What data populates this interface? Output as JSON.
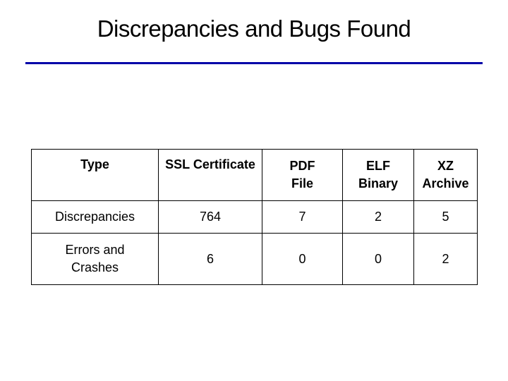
{
  "title": "Discrepancies and Bugs Found",
  "colors": {
    "rule": "#0000a8"
  },
  "table": {
    "headers": [
      {
        "lines": [
          "Type"
        ]
      },
      {
        "lines": [
          "SSL Certificate"
        ]
      },
      {
        "lines": [
          "PDF",
          "File"
        ]
      },
      {
        "lines": [
          "ELF",
          "Binary"
        ]
      },
      {
        "lines": [
          "XZ",
          "Archive"
        ]
      }
    ],
    "rows": [
      {
        "label_lines": [
          "Discrepancies"
        ],
        "values": [
          "764",
          "7",
          "2",
          "5"
        ]
      },
      {
        "label_lines": [
          "Errors and",
          "Crashes"
        ],
        "values": [
          "6",
          "0",
          "0",
          "2"
        ]
      }
    ]
  }
}
